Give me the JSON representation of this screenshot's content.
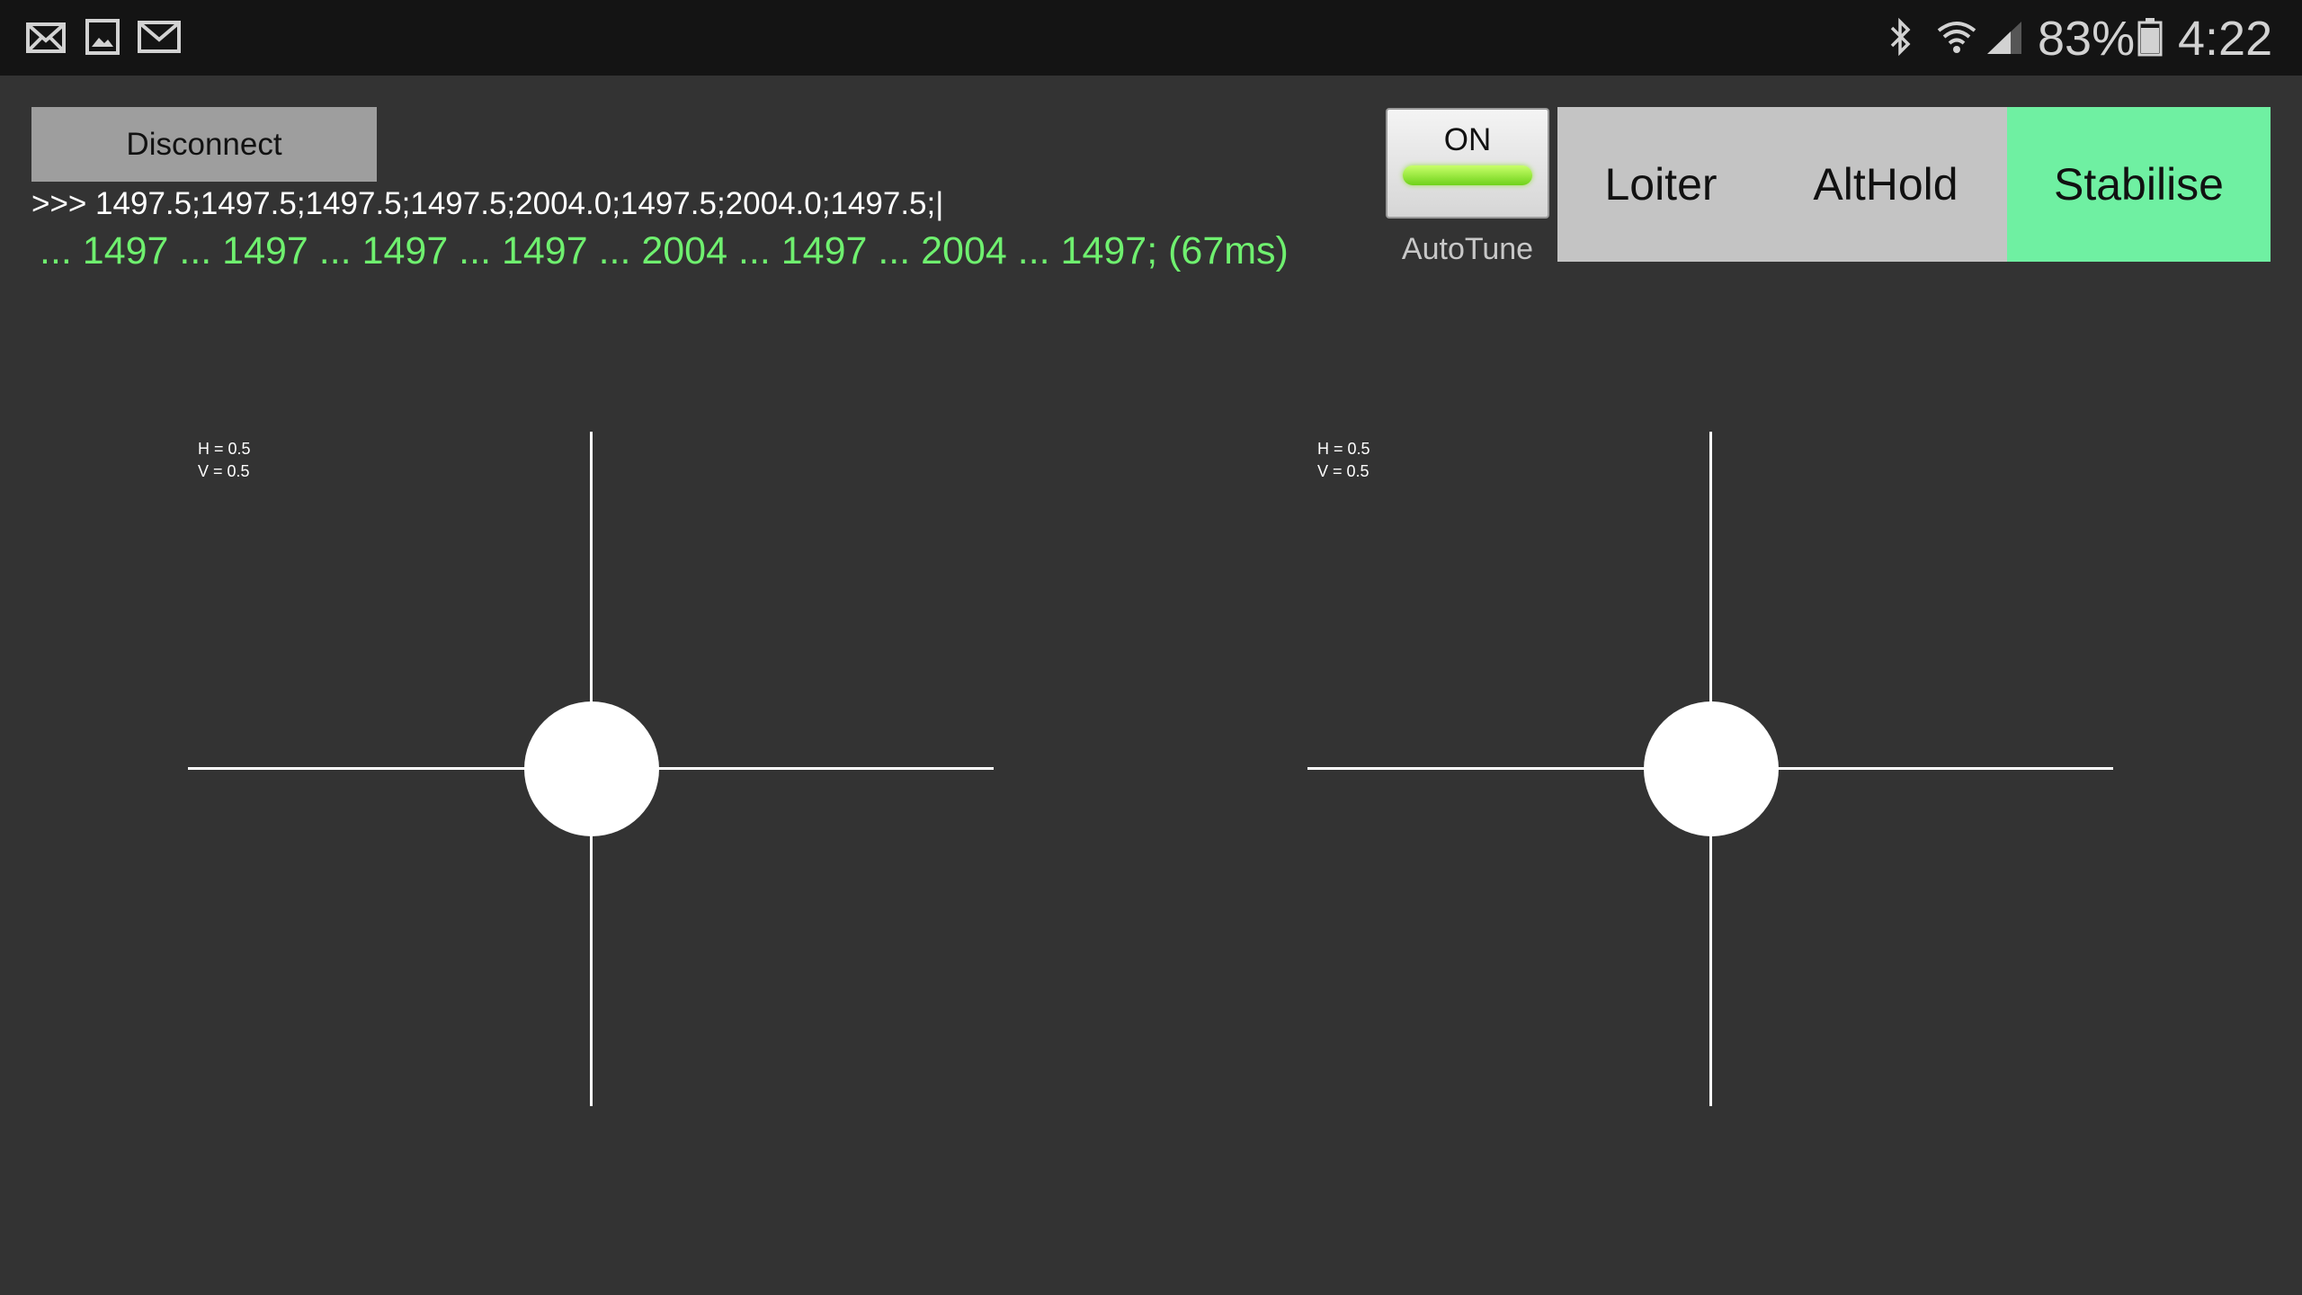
{
  "status_bar": {
    "notification_icons": [
      "email-icon",
      "image-icon",
      "gmail-icon"
    ],
    "system_icons": [
      "bluetooth-icon",
      "wifi-icon",
      "signal-icon",
      "battery-icon"
    ],
    "battery": "83%",
    "time": "4:22"
  },
  "connection": {
    "disconnect_label": "Disconnect",
    "raw_output": ">>> 1497.5;1497.5;1497.5;1497.5;2004.0;1497.5;2004.0;1497.5;|",
    "parsed_output": "... 1497 ... 1497 ... 1497 ... 1497 ... 2004 ... 1497 ... 2004 ... 1497; (67ms)"
  },
  "autotune": {
    "toggle_label": "ON",
    "state": "on",
    "label": "AutoTune"
  },
  "modes": {
    "items": [
      "Loiter",
      "AltHold",
      "Stabilise"
    ],
    "selected": "Stabilise",
    "selected_color": "#6ff0a2"
  },
  "joysticks": {
    "left": {
      "h": 0.5,
      "v": 0.5,
      "h_text": "H = 0.5",
      "v_text": "V = 0.5"
    },
    "right": {
      "h": 0.5,
      "v": 0.5,
      "h_text": "H = 0.5",
      "v_text": "V = 0.5"
    }
  },
  "colors": {
    "background": "#333333",
    "status_bar": "#141414",
    "accent_green": "#6ff06f"
  }
}
